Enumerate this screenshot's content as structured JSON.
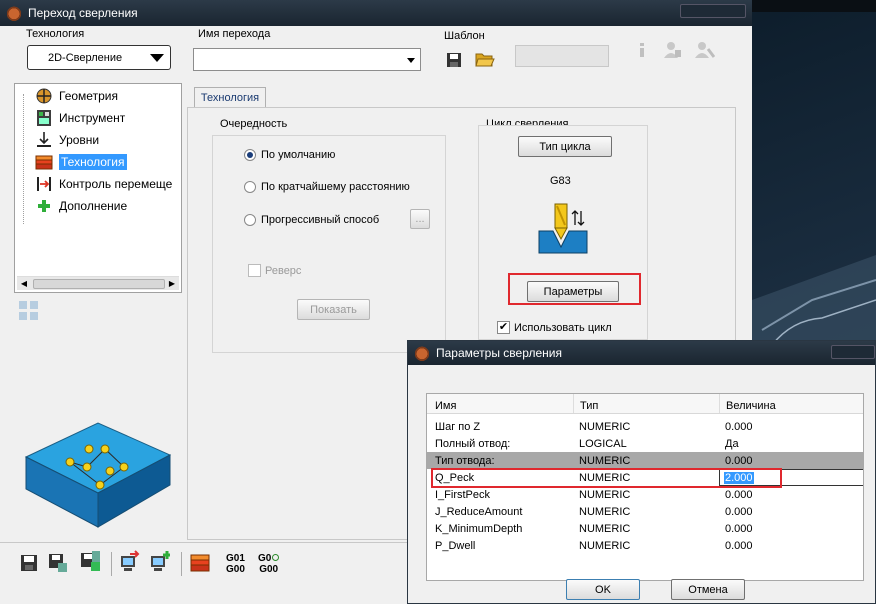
{
  "main_window": {
    "title": "Переход сверления",
    "technology_label": "Технология",
    "technology_value": "2D-Сверление",
    "transition_name_label": "Имя перехода",
    "transition_name_value": "",
    "template_label": "Шаблон",
    "template_value": ""
  },
  "tree": {
    "items": [
      {
        "label": "Геометрия",
        "icon": "geometry-icon"
      },
      {
        "label": "Инструмент",
        "icon": "tool-icon"
      },
      {
        "label": "Уровни",
        "icon": "levels-icon"
      },
      {
        "label": "Технология",
        "icon": "technology-icon",
        "selected": true
      },
      {
        "label": "Контроль перемеще",
        "icon": "motion-control-icon"
      },
      {
        "label": "Дополнение",
        "icon": "plus-icon"
      }
    ]
  },
  "tech_tab": {
    "tab_label": "Технология",
    "order_group": "Очередность",
    "radio_default": "По умолчанию",
    "radio_shortest": "По кратчайшему расстоянию",
    "radio_progressive": "Прогрессивный способ",
    "ellipsis": "...",
    "reverse_label": "Реверс",
    "show_button": "Показать",
    "cycle_group": "Цикл сверления",
    "cycle_type_button": "Тип цикла",
    "cycle_code": "G83",
    "params_button": "Параметры",
    "use_cycle_label": "Использовать цикл"
  },
  "bottom_toolbar": {
    "g01": "G01",
    "g00": "G00",
    "g00b": "G0",
    "g00c": "G00"
  },
  "params_dialog": {
    "title": "Параметры сверления",
    "columns": [
      "Имя",
      "Тип",
      "Величина"
    ],
    "rows": [
      {
        "name": "Шаг по Z",
        "type": "NUMERIC",
        "value": "0.000"
      },
      {
        "name": "Полный отвод:",
        "type": "LOGICAL",
        "value": "Да"
      },
      {
        "name": "Тип отвода:",
        "type": "NUMERIC",
        "value": "0.000"
      },
      {
        "name": "Q_Peck",
        "type": "NUMERIC",
        "value": "2.000"
      },
      {
        "name": "I_FirstPeck",
        "type": "NUMERIC",
        "value": "0.000"
      },
      {
        "name": "J_ReduceAmount",
        "type": "NUMERIC",
        "value": "0.000"
      },
      {
        "name": "K_MinimumDepth",
        "type": "NUMERIC",
        "value": "0.000"
      },
      {
        "name": "P_Dwell",
        "type": "NUMERIC",
        "value": "0.000"
      }
    ],
    "ok_button": "OK",
    "cancel_button": "Отмена"
  },
  "colors": {
    "highlight_red": "#e0282e",
    "selection_blue": "#3399ff",
    "gray_row": "#a8a8a8"
  }
}
